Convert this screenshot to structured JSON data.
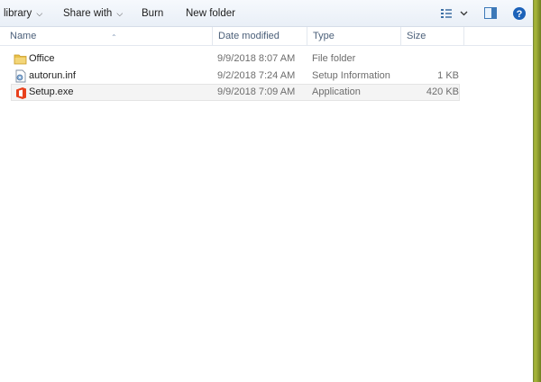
{
  "toolbar": {
    "library_label": "library",
    "share_label": "Share with",
    "burn_label": "Burn",
    "new_folder_label": "New folder",
    "view_icon": "view-options-icon",
    "pane_icon": "preview-pane-icon",
    "help_icon": "help-icon"
  },
  "columns": {
    "name": "Name",
    "date": "Date modified",
    "type": "Type",
    "size": "Size"
  },
  "files": [
    {
      "name": "Office",
      "date": "9/9/2018 8:07 AM",
      "type": "File folder",
      "size": "",
      "icon": "folder-icon"
    },
    {
      "name": "autorun.inf",
      "date": "9/2/2018 7:24 AM",
      "type": "Setup Information",
      "size": "1 KB",
      "icon": "settings-file-icon"
    },
    {
      "name": "Setup.exe",
      "date": "9/9/2018 7:09 AM",
      "type": "Application",
      "size": "420 KB",
      "icon": "office-app-icon"
    }
  ],
  "colors": {
    "office_red": "#e8401c",
    "folder_yellow": "#e8c04a",
    "header_text": "#4c607a",
    "help_blue": "#1c62b9"
  }
}
